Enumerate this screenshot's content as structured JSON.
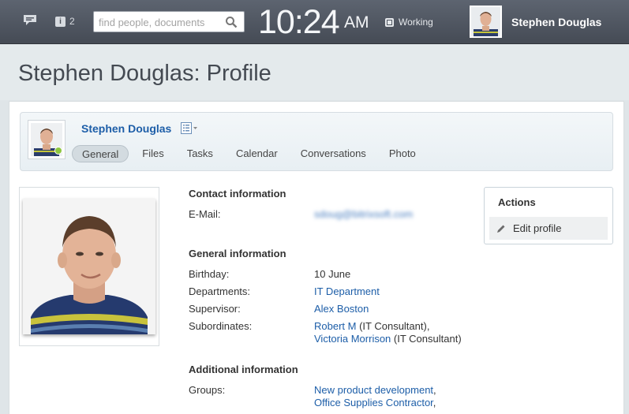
{
  "topbar": {
    "notification_count": "2",
    "search_placeholder": "find people, documents",
    "clock_time": "10:24",
    "clock_ampm": "AM",
    "status_label": "Working",
    "user_name": "Stephen Douglas"
  },
  "page": {
    "title": "Stephen Douglas: Profile"
  },
  "profile_header": {
    "name": "Stephen Douglas",
    "tabs": [
      {
        "label": "General",
        "active": true
      },
      {
        "label": "Files"
      },
      {
        "label": "Tasks"
      },
      {
        "label": "Calendar"
      },
      {
        "label": "Conversations"
      },
      {
        "label": "Photo"
      }
    ]
  },
  "contact": {
    "heading": "Contact information",
    "email_label": "E-Mail:",
    "email_value": "sdoug@bitrixsoft.com"
  },
  "general": {
    "heading": "General information",
    "birthday_label": "Birthday:",
    "birthday_value": "10 June",
    "departments_label": "Departments:",
    "departments_value": "IT Department",
    "supervisor_label": "Supervisor:",
    "supervisor_value": "Alex Boston",
    "subordinates_label": "Subordinates:",
    "subordinates": [
      {
        "name": "Robert M",
        "role": " (IT Consultant),"
      },
      {
        "name": "Victoria Morrison",
        "role": " (IT Consultant)"
      }
    ]
  },
  "additional": {
    "heading": "Additional information",
    "groups_label": "Groups:",
    "groups": [
      {
        "name": "New product development",
        "sep": ","
      },
      {
        "name": "Office Supplies Contractor",
        "sep": ","
      }
    ]
  },
  "actions": {
    "title": "Actions",
    "edit_label": "Edit profile"
  },
  "colors": {
    "link": "#1d5ea8",
    "topbar": "#4f5560",
    "online": "#8dc63f"
  }
}
